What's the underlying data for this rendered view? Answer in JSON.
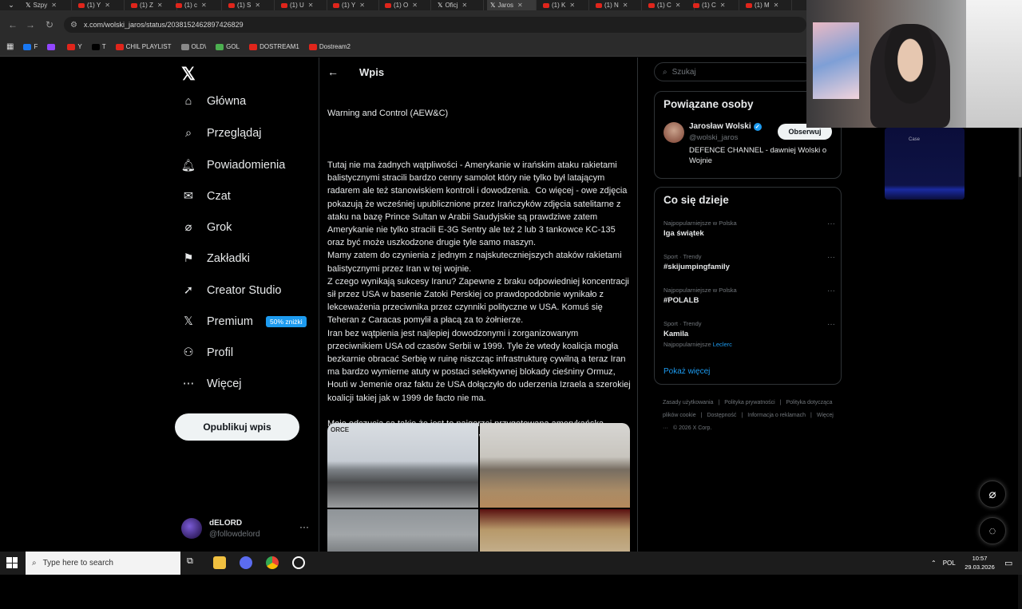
{
  "browser": {
    "tabs": [
      {
        "label": "Szpy",
        "icon": "x-logo-icon"
      },
      {
        "label": "(1) Y",
        "icon": "youtube-icon"
      },
      {
        "label": "(1) Z",
        "icon": "youtube-icon"
      },
      {
        "label": "(1) c",
        "icon": "youtube-icon"
      },
      {
        "label": "(1) S",
        "icon": "youtube-icon"
      },
      {
        "label": "(1) U",
        "icon": "youtube-icon"
      },
      {
        "label": "(1) Y",
        "icon": "youtube-icon"
      },
      {
        "label": "(1) O",
        "icon": "youtube-icon"
      },
      {
        "label": "Oficj",
        "icon": "x-logo-icon"
      },
      {
        "label": "Jaros",
        "icon": "x-logo-icon"
      },
      {
        "label": "(1) K",
        "icon": "youtube-icon"
      },
      {
        "label": "(1) N",
        "icon": "youtube-icon"
      },
      {
        "label": "(1) C",
        "icon": "youtube-icon"
      },
      {
        "label": "(1) C",
        "icon": "youtube-icon"
      },
      {
        "label": "(1) M",
        "icon": "youtube-icon"
      }
    ],
    "url": "x.com/wolski_jaros/status/2038152462897426829",
    "bookmarks": [
      {
        "label": "F",
        "color": "#1877f2"
      },
      {
        "label": "",
        "color": "#9146ff"
      },
      {
        "label": "Y",
        "color": "#e0251b"
      },
      {
        "label": "T",
        "color": "#000000"
      },
      {
        "label": "CHIL PLAYLIST",
        "color": "#e0251b"
      },
      {
        "label": "OLD\\",
        "color": "#888888"
      },
      {
        "label": "GOL",
        "color": "#4caf50"
      },
      {
        "label": "DOSTREAM1",
        "color": "#e0251b"
      },
      {
        "label": "Dostream2",
        "color": "#e0251b"
      }
    ]
  },
  "nav": {
    "items": [
      {
        "label": "Główna",
        "icon": "home-icon"
      },
      {
        "label": "Przeglądaj",
        "icon": "search-icon"
      },
      {
        "label": "Powiadomienia",
        "icon": "bell-icon"
      },
      {
        "label": "Czat",
        "icon": "mail-icon"
      },
      {
        "label": "Grok",
        "icon": "grok-icon"
      },
      {
        "label": "Zakładki",
        "icon": "bookmark-icon"
      },
      {
        "label": "Creator Studio",
        "icon": "rocket-icon"
      },
      {
        "label": "Premium",
        "icon": "x-logo-icon"
      },
      {
        "label": "Profil",
        "icon": "person-icon"
      },
      {
        "label": "Więcej",
        "icon": "more-circle-icon"
      }
    ],
    "premium_badge": "50% zniżki",
    "post_button": "Opublikuj wpis",
    "account": {
      "name": "dELORD",
      "handle": "@followdelord",
      "more": "···"
    }
  },
  "post": {
    "header_title": "Wpis",
    "top_fragment": "Warning and Control (AEW&C)",
    "paragraphs": [
      "Tutaj nie ma żadnych wątpliwości - Amerykanie w irańskim ataku rakietami balistycznymi stracili bardzo cenny samolot który nie tylko był latającym radarem ale też stanowiskiem kontroli i dowodzenia.  Co więcej - owe zdjęcia pokazują że wcześniej upublicznione przez Irańczyków zdjęcia satelitarne z ataku na bazę Prince Sultan w Arabii Saudyjskie są prawdziwe zatem Amerykanie nie tylko stracili E-3G Sentry ale też 2 lub 3 tankowce KC-135 oraz być może uszkodzone drugie tyle samo maszyn.",
      "Mamy zatem do czynienia z jednym z najskuteczniejszych ataków rakietami balistycznymi przez Iran w tej wojnie.",
      "Z czego wynikają sukcesy Iranu? Zapewne z braku odpowiedniej koncentracji sił przez USA w basenie Zatoki Perskiej co prawdopodobnie wynikało z lekceważenia przeciwnika przez czynniki polityczne w USA. Komuś się Teheran z Caracas pomylił a płacą za to żołnierze.",
      "Iran bez wątpienia jest najlepiej dowodzonymi i zorganizowanym przeciwnikiem USA od czasów Serbii w 1999. Tyle że wtedy koalicja mogła bezkarnie obracać Serbię w ruinę niszcząc infrastrukturę cywilną a teraz Iran ma bardzo wymierne atuty w postaci selektywnej blokady cieśniny Ormuz, Houti w Jemenie oraz faktu że USA dołączyło do uderzenia Izraela a szerokiej koalicji takiej jak w 1999 de facto nie ma.",
      "",
      "Moje odczucia są takie że jest to najgorzej przygotowana amerykańska interwencja od czasów mroków zimnej wojny na dodatek fatalnie rozgrywana politycznie."
    ],
    "media_caption_1": "ORCE"
  },
  "right": {
    "search_placeholder": "Szukaj",
    "related_title": "Powiązane osoby",
    "person": {
      "name": "Jarosław Wolski",
      "handle": "@wolski_jaros",
      "bio": "DEFENCE CHANNEL - dawniej Wolski o Wojnie",
      "follow": "Obserwuj"
    },
    "trends_title": "Co się dzieje",
    "trends": [
      {
        "context": "Najpopularniejsze w Polska",
        "name": "Iga świątek",
        "sub": "",
        "sub_link": ""
      },
      {
        "context": "Sport · Trendy",
        "name": "#skijumpingfamily",
        "sub": "",
        "sub_link": ""
      },
      {
        "context": "Najpopularniejsze w Polska",
        "name": "#POLALB",
        "sub": "",
        "sub_link": ""
      },
      {
        "context": "Sport · Trendy",
        "name": "Kamila",
        "sub": "Najpopularniejsze",
        "sub_link": "Leclerc"
      }
    ],
    "show_more": "Pokaż więcej",
    "footer": [
      "Zasady użytkowania",
      "|",
      "Polityka prywatności",
      "|",
      "Polityka dotycząca plików cookie",
      "|",
      "Dostępność",
      "|",
      "Informacja o reklamach",
      "|",
      "Więcej ···",
      "© 2026 X Corp."
    ]
  },
  "stream": {
    "widget_text": "Case"
  },
  "taskbar": {
    "search_placeholder": "Type here to search",
    "lang": "POL",
    "time": "10:57",
    "date": "29.03.2026"
  }
}
